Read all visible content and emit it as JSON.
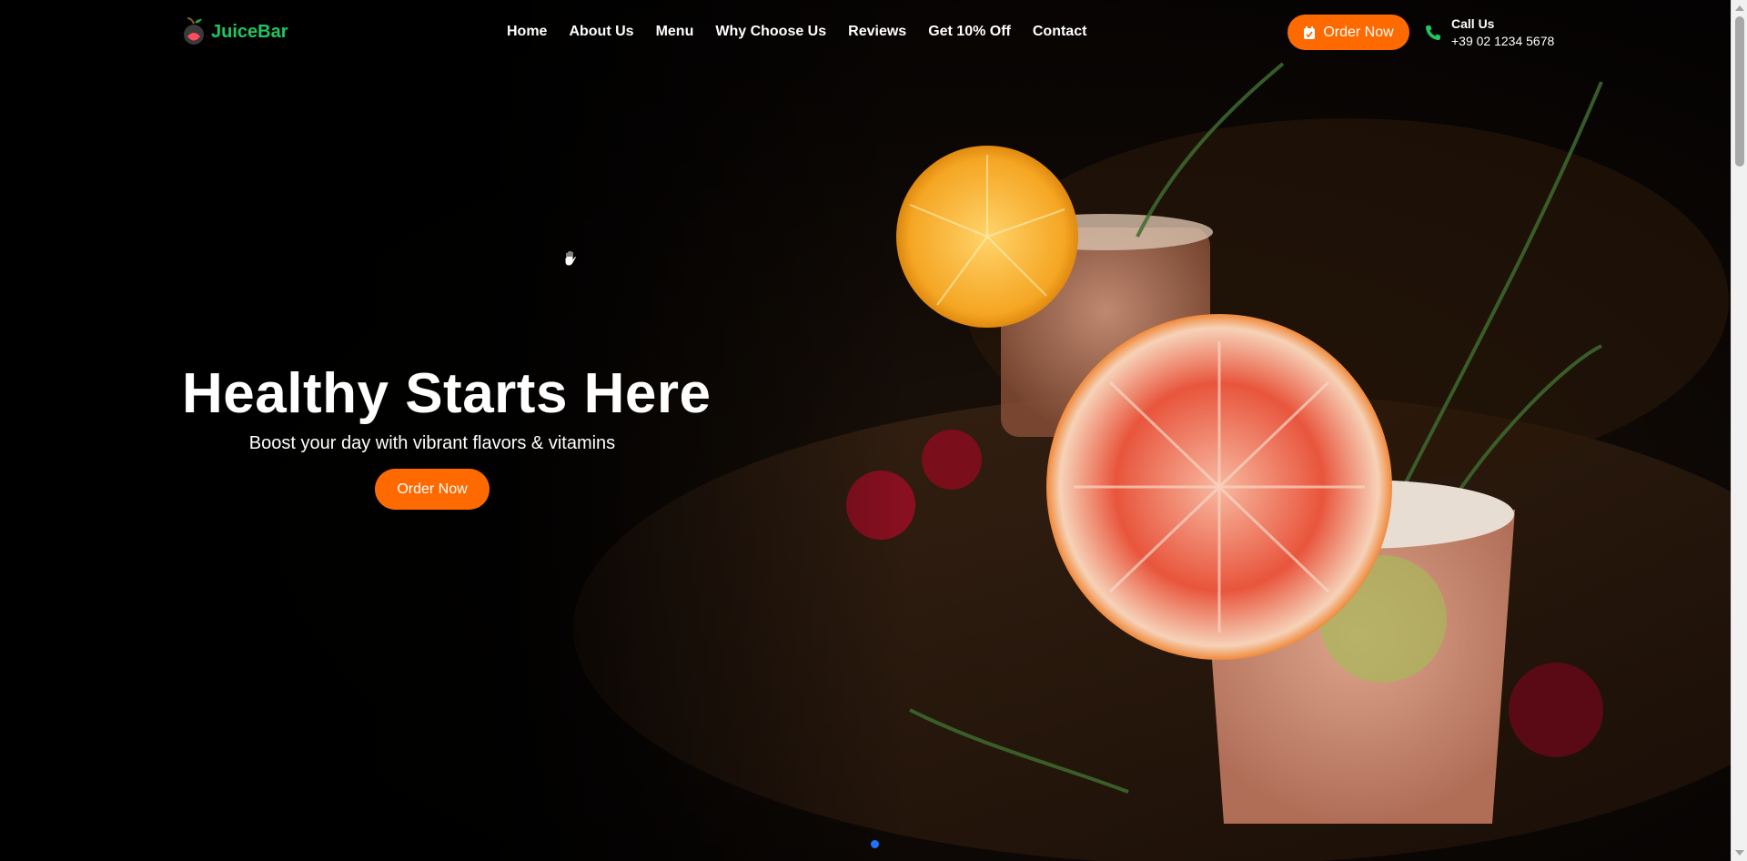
{
  "brand": {
    "name": "JuiceBar",
    "icon": "apple-icon",
    "color": "#22c55e"
  },
  "nav": {
    "items": [
      {
        "label": "Home"
      },
      {
        "label": "About Us"
      },
      {
        "label": "Menu"
      },
      {
        "label": "Why Choose Us"
      },
      {
        "label": "Reviews"
      },
      {
        "label": "Get 10% Off"
      },
      {
        "label": "Contact"
      }
    ]
  },
  "header": {
    "order_label": "Order Now",
    "order_icon": "calendar-icon",
    "call_title": "Call Us",
    "call_number": "+39 02 1234 5678",
    "call_icon": "phone-icon"
  },
  "hero": {
    "title": "Healthy Starts Here",
    "subtitle": "Boost your day with vibrant flavors & vitamins",
    "cta_label": "Order Now",
    "slide_count": 1,
    "active_slide": 1
  },
  "colors": {
    "accent": "#ff6a00",
    "brand": "#22c55e",
    "indicator": "#1e74ff"
  }
}
